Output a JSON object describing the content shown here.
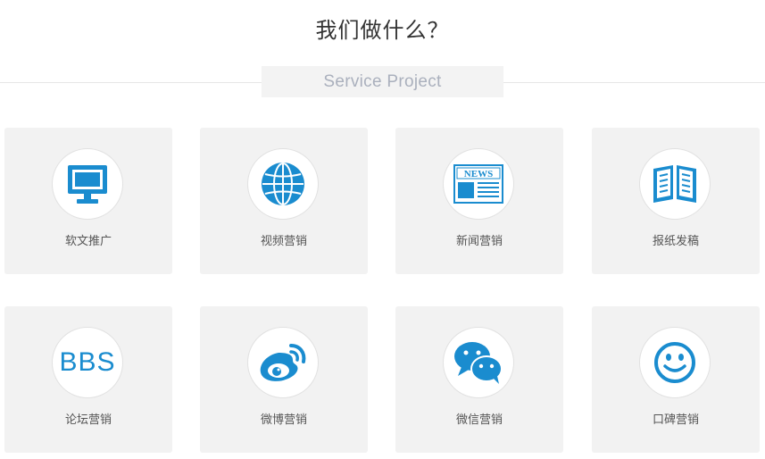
{
  "header": {
    "title": "我们做什么？",
    "subtitle": "Service Project"
  },
  "colors": {
    "accent": "#1a8ccf",
    "card_bg": "#f2f2f2",
    "subtitle_text": "#aab0bd"
  },
  "services": [
    {
      "label": "软文推广",
      "icon": "monitor-icon"
    },
    {
      "label": "视频营销",
      "icon": "globe-icon"
    },
    {
      "label": "新闻营销",
      "icon": "newspaper-icon"
    },
    {
      "label": "报纸发稿",
      "icon": "open-book-icon"
    },
    {
      "label": "论坛营销",
      "icon": "bbs-icon",
      "icon_text": "BBS"
    },
    {
      "label": "微博营销",
      "icon": "weibo-icon"
    },
    {
      "label": "微信营销",
      "icon": "wechat-icon"
    },
    {
      "label": "口碑营销",
      "icon": "smiley-icon"
    }
  ]
}
